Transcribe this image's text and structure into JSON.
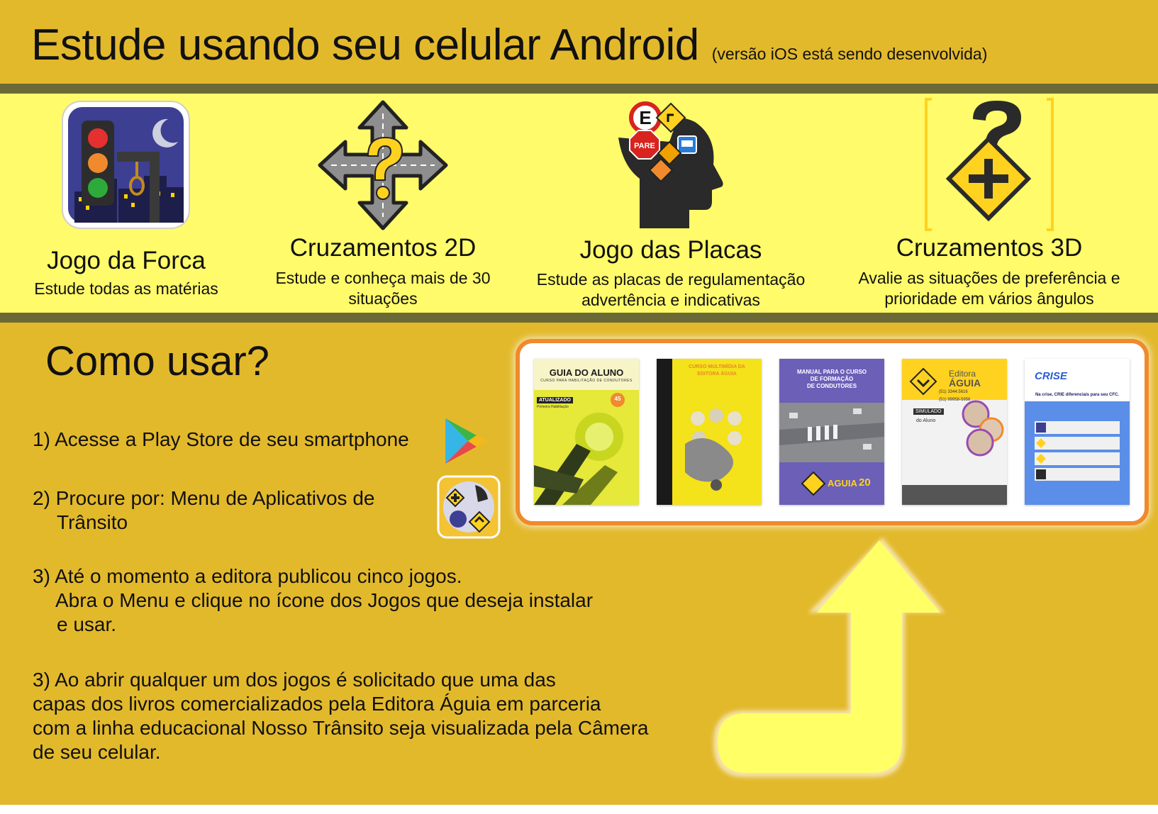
{
  "header": {
    "title": "Estude usando seu celular Android",
    "note": "(versão iOS está sendo desenvolvida)"
  },
  "apps": [
    {
      "title": "Jogo da Forca",
      "description": "Estude todas as matérias",
      "icon": "traffic-light-gallows-icon"
    },
    {
      "title": "Cruzamentos 2D",
      "description": "Estude e conheça mais de 30 situações",
      "icon": "crossroads-arrows-icon"
    },
    {
      "title": "Jogo das Placas",
      "description": "Estude as placas de regulamentação advertência e indicativas",
      "icon": "head-with-signs-icon"
    },
    {
      "title": "Cruzamentos 3D",
      "description": "Avalie as situações de preferência e prioridade em vários ângulos",
      "icon": "question-intersection-sign-icon"
    }
  ],
  "howto": {
    "title": "Como usar?",
    "step1": "1) Acesse a Play Store de seu smartphone",
    "step2_line1": "2) Procure por: Menu de Aplicativos de",
    "step2_line2": "Trânsito",
    "step3_line1": "3) Até o momento a editora publicou cinco jogos.",
    "step3_line2": "Abra o Menu e clique no ícone dos Jogos que deseja instalar",
    "step3_line3": "e usar.",
    "step4_line1": "3) Ao abrir qualquer um dos jogos é solicitado que uma das",
    "step4_line2": "capas dos livros comercializados pela Editora Águia em parceria",
    "step4_line3": "com a linha educacional Nosso Trânsito seja visualizada pela Câmera",
    "step4_line4": "de seu celular."
  },
  "books": {
    "book1": {
      "title": "GUIA DO ALUNO",
      "subtitle": "CURSO PARA HABILITAÇÃO DE CONDUTORES",
      "badge": "ATUALIZADO",
      "badge_sub": "Primeira Habilitação",
      "seal": "45"
    },
    "book2": {
      "title_line1": "CURSO MULTIMÍDIA DA",
      "title_line2": "EDITORA ÁGUIA"
    },
    "book3": {
      "title_line1": "MANUAL PARA O CURSO",
      "title_line2": "DE FORMAÇÃO",
      "title_line3": "DE CONDUTORES",
      "brand": "AGUIA",
      "edition": "20"
    },
    "book4": {
      "brand_line1": "Editora",
      "brand_line2": "ÁGUIA",
      "phone1": "(51) 3344.5616",
      "phone2": "(51) 99958-5956",
      "label1": "SIMULADO",
      "label2": "do Aluno"
    },
    "book5": {
      "logo": "CRISE",
      "headline": "Na crise, CRIE diferenciais para seu CFC."
    }
  },
  "colors": {
    "gold": "#e3b92c",
    "light_yellow": "#fffb6a",
    "stripe": "#6b6a36",
    "frame_orange": "#f08a2c",
    "arrow_yellow": "#ffff66"
  }
}
